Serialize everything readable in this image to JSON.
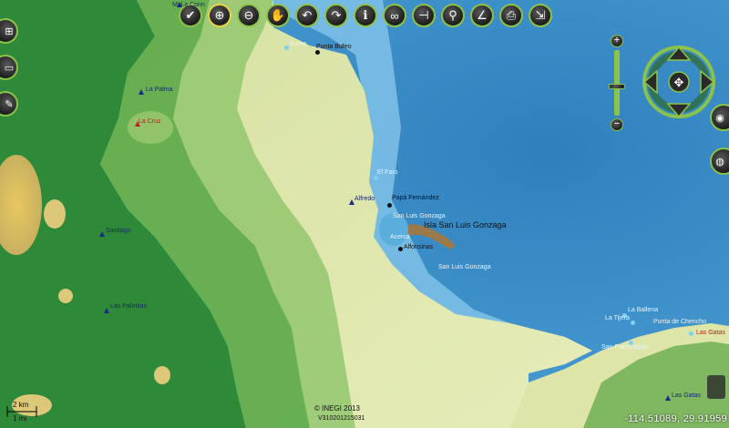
{
  "colors": {
    "sea": "#3a8fc8",
    "shallow": "#7fc2e8",
    "lowland": "#e0e8a8",
    "forest": "#2e8a38",
    "hills": "#dccc78",
    "ui_ring": "#8bc34a"
  },
  "toolbar": [
    {
      "name": "select-tool",
      "icon": "check-icon",
      "glyph": "✔"
    },
    {
      "name": "zoom-in-tool",
      "icon": "magnifier-plus-icon",
      "glyph": "⊕"
    },
    {
      "name": "zoom-out-tool",
      "icon": "magnifier-minus-icon",
      "glyph": "⊖"
    },
    {
      "name": "pan-tool",
      "icon": "hand-icon",
      "glyph": "✋"
    },
    {
      "name": "back-tool",
      "icon": "arrow-back-icon",
      "glyph": "↶"
    },
    {
      "name": "forward-tool",
      "icon": "arrow-forward-icon",
      "glyph": "↷"
    },
    {
      "name": "info-tool",
      "icon": "info-icon",
      "glyph": "ℹ"
    },
    {
      "name": "binoculars-tool",
      "icon": "binoculars-icon",
      "glyph": "∞"
    },
    {
      "name": "measure-tool",
      "icon": "ruler-icon",
      "glyph": "⊣"
    },
    {
      "name": "pin-tool",
      "icon": "pushpin-icon",
      "glyph": "⚲"
    },
    {
      "name": "angle-tool",
      "icon": "angle-icon",
      "glyph": "∠"
    },
    {
      "name": "print-tool",
      "icon": "printer-icon",
      "glyph": "⎙"
    },
    {
      "name": "export-tool",
      "icon": "export-icon",
      "glyph": "⇲"
    }
  ],
  "left_buttons": [
    {
      "name": "layers-tree-button",
      "icon": "tree-icon",
      "glyph": "⊞"
    },
    {
      "name": "overview-button",
      "icon": "map-icon",
      "glyph": "▭"
    },
    {
      "name": "tools-button",
      "icon": "pencil-icon",
      "glyph": "✎"
    }
  ],
  "right_buttons": [
    {
      "name": "view-button",
      "icon": "eye-icon",
      "glyph": "◉"
    },
    {
      "name": "globe-button",
      "icon": "globe-icon",
      "glyph": "◍"
    }
  ],
  "places": {
    "malaconn": "Mal.a Conn",
    "la_palma": "La Palma",
    "la_cruz": "La Cruz",
    "santiago": "Santiago",
    "las_palmitas": "Las Palmitas",
    "bufeo": "Bufeo",
    "punta_bufeo": "Punta Bufeo",
    "el_faro": "El Faro",
    "alfredo": "Alfredo",
    "papa_fernandez": "Papá Fernández",
    "san_luis_gonzaga_bay": "San Luis Gonzaga",
    "isla": "Isla San Luis Gonzaga",
    "acerca": "Acerca",
    "alfonsinas": "Alfonsinas",
    "san_luis_gonzaga": "San Luis Gonzaga",
    "la_ballena": "La Ballena",
    "la_tijera": "La Tijera",
    "punta_chencho": "Punta de Chencho",
    "las_gatas_top": "Las Gatas",
    "san_francisquito": "San Francisquito",
    "las_gatas": "Las Gatas"
  },
  "scale": {
    "km": "2 km",
    "mi": "1 mi"
  },
  "copyright": "© INEGI 2013",
  "version": "V310201215031",
  "coordinates": "-114.51089, 29.91959"
}
